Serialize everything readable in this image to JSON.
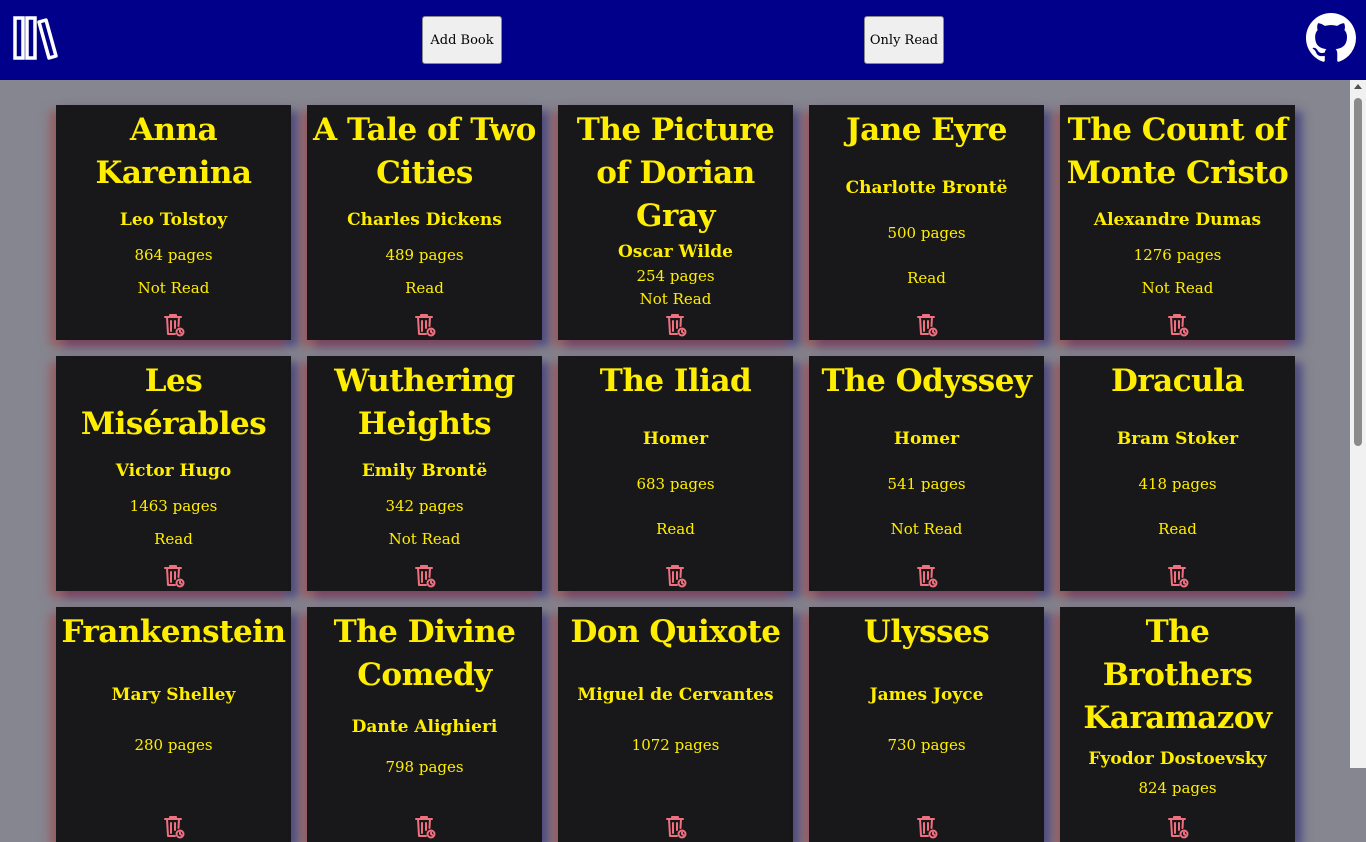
{
  "header": {
    "add_label": "Add Book",
    "filter_label": "Only Read"
  },
  "books": [
    {
      "title": "Anna Karenina",
      "author": "Leo Tolstoy",
      "pages": "864 pages",
      "status": "Not Read"
    },
    {
      "title": "A Tale of Two Cities",
      "author": "Charles Dickens",
      "pages": "489 pages",
      "status": "Read"
    },
    {
      "title": "The Picture of Dorian Gray",
      "author": "Oscar Wilde",
      "pages": "254 pages",
      "status": "Not Read"
    },
    {
      "title": "Jane Eyre",
      "author": "Charlotte Brontë",
      "pages": "500 pages",
      "status": "Read"
    },
    {
      "title": "The Count of Monte Cristo",
      "author": "Alexandre Dumas",
      "pages": "1276 pages",
      "status": "Not Read"
    },
    {
      "title": "Les Misérables",
      "author": "Victor Hugo",
      "pages": "1463 pages",
      "status": "Read"
    },
    {
      "title": "Wuthering Heights",
      "author": "Emily Brontë",
      "pages": "342 pages",
      "status": "Not Read"
    },
    {
      "title": "The Iliad",
      "author": "Homer",
      "pages": "683 pages",
      "status": "Read"
    },
    {
      "title": "The Odyssey",
      "author": "Homer",
      "pages": "541 pages",
      "status": "Not Read"
    },
    {
      "title": "Dracula",
      "author": "Bram Stoker",
      "pages": "418 pages",
      "status": "Read"
    },
    {
      "title": "Frankenstein",
      "author": "Mary Shelley",
      "pages": "280 pages",
      "status": ""
    },
    {
      "title": "The Divine Comedy",
      "author": "Dante Alighieri",
      "pages": "798 pages",
      "status": ""
    },
    {
      "title": "Don Quixote",
      "author": "Miguel de Cervantes",
      "pages": "1072 pages",
      "status": ""
    },
    {
      "title": "Ulysses",
      "author": "James Joyce",
      "pages": "730 pages",
      "status": ""
    },
    {
      "title": "The Brothers Karamazov",
      "author": "Fyodor Dostoevsky",
      "pages": "824 pages",
      "status": ""
    }
  ],
  "icons": {
    "logo": "books-logo-icon",
    "github": "github-icon",
    "delete": "trash-icon"
  },
  "colors": {
    "header_bg": "#00008b",
    "page_bg": "#868690",
    "card_bg": "#18181a",
    "card_text": "#ffee00",
    "delete_icon": "#f07080"
  }
}
